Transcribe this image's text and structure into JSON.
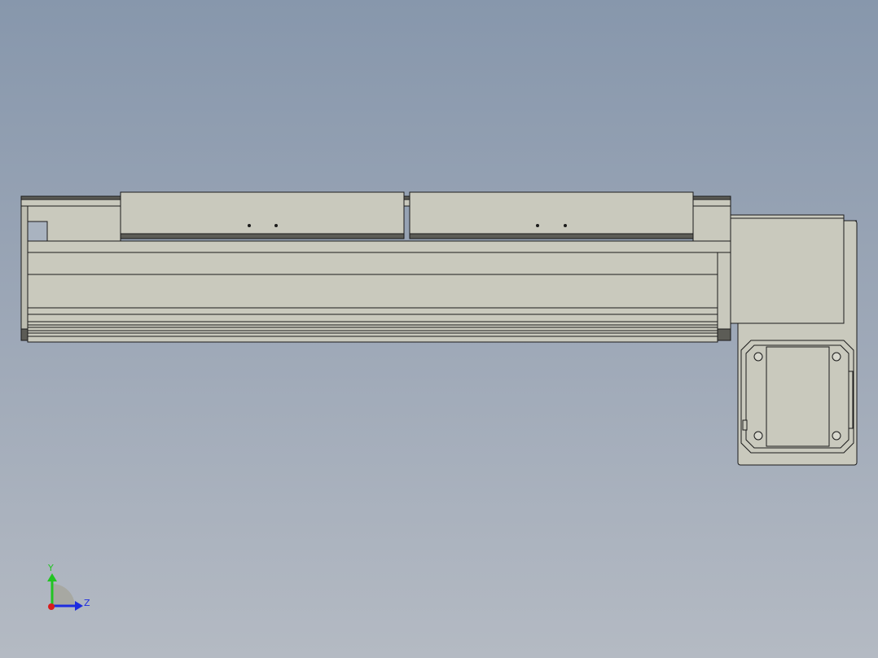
{
  "viewport": {
    "background_top": "#8797ac",
    "background_bottom": "#b4bac3"
  },
  "model": {
    "part_fill": "#c9c9bd",
    "part_fill_dark": "#bdbdb1",
    "edge_color": "#1a1a1a",
    "dark_strip": "#5c5c56"
  },
  "triad": {
    "y_label": "Y",
    "z_label": "Z",
    "y_color": "#22c422",
    "z_color": "#1d2ce0",
    "x_color": "#d81c1c"
  }
}
